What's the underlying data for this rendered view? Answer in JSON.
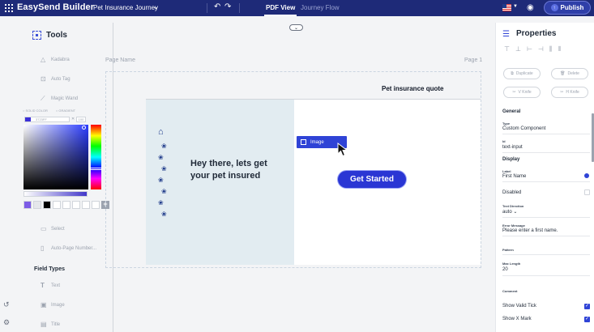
{
  "topbar": {
    "brand": "EasySend Builder",
    "journey_name": "Pet Insurance Journey",
    "tabs": [
      {
        "label": "PDF View",
        "active": true
      },
      {
        "label": "Journey Flow",
        "active": false
      }
    ],
    "publish_label": "Publish"
  },
  "left": {
    "title": "Tools",
    "tools_top": [
      "Kadabra",
      "Auto Tag",
      "Magic Wand"
    ],
    "color_picker": {
      "tabs": [
        "SOLID COLOR",
        "GRADIENT"
      ],
      "hex": "3723FF",
      "alpha": "100",
      "swatches": [
        "#7c5ce6",
        "#e5e7eb",
        "#000000",
        "#ffffff",
        "#ffffff",
        "#ffffff",
        "#ffffff",
        "#ffffff"
      ]
    },
    "tools_bottom": [
      "Select",
      "Auto-Page Number..."
    ],
    "field_types_title": "Field Types",
    "field_types": [
      "Text",
      "Image",
      "Title"
    ]
  },
  "canvas": {
    "page_name": "Page Name",
    "page_number": "Page 1",
    "quote_title": "Pet insurance quote",
    "hero_text": "Hey there, lets get your pet insured",
    "drag_chip": "Image",
    "cta": "Get Started"
  },
  "right": {
    "title": "Properties",
    "buttons": [
      "Duplicate",
      "Delete",
      "V Knife",
      "H Knife"
    ],
    "general": {
      "heading": "General",
      "type_label": "Type",
      "type_value": "Custom Component",
      "id_label": "Id",
      "id_value": "text-input"
    },
    "display": {
      "heading": "Display",
      "label_label": "Label",
      "label_value": "First Name",
      "disabled_label": "Disabled",
      "direction_label": "Text Direction",
      "direction_value": "auto",
      "error_label": "Error Message",
      "error_value": "Please enter a first name.",
      "pattern_label": "Pattern",
      "maxlength_label": "Max Length",
      "maxlength_value": "20",
      "comment_label": "Comment",
      "valid_tick": "Show Valid Tick",
      "x_mark": "Show X Mark"
    }
  }
}
